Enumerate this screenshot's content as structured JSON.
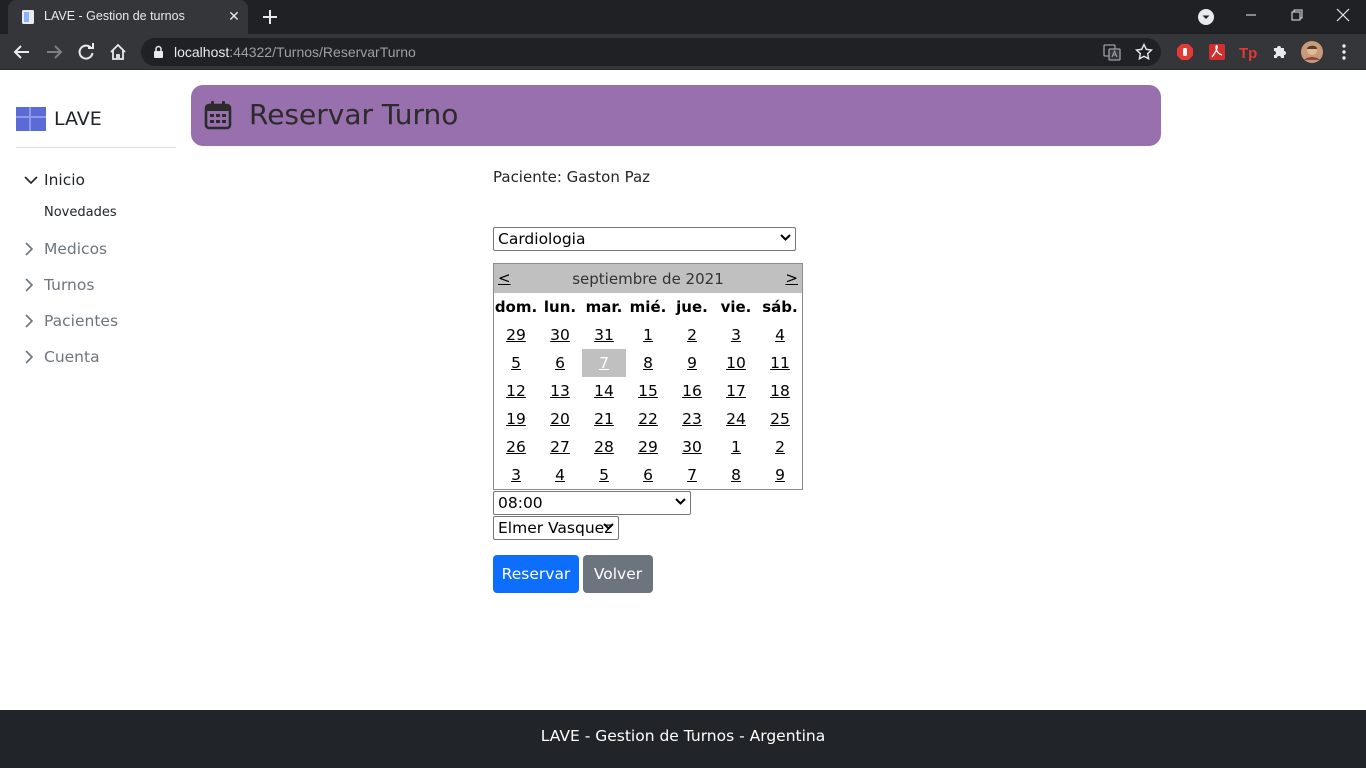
{
  "browser": {
    "tab_title": "LAVE - Gestion de turnos",
    "url_host": "localhost",
    "url_rest": ":44322/Turnos/ReservarTurno"
  },
  "sidebar": {
    "brand": "LAVE",
    "items": [
      {
        "label": "Inicio",
        "expanded": true
      },
      {
        "label": "Medicos",
        "expanded": false
      },
      {
        "label": "Turnos",
        "expanded": false
      },
      {
        "label": "Pacientes",
        "expanded": false
      },
      {
        "label": "Cuenta",
        "expanded": false
      }
    ],
    "subitems": [
      "Novedades"
    ]
  },
  "header": {
    "title": "Reservar Turno"
  },
  "patient_label": "Paciente: Gaston Paz",
  "specialty_select": {
    "value": "Cardiologia"
  },
  "calendar": {
    "title": "septiembre de 2021",
    "prev": "<",
    "next": ">",
    "weekdays": [
      "dom.",
      "lun.",
      "mar.",
      "mié.",
      "jue.",
      "vie.",
      "sáb."
    ],
    "weeks": [
      [
        "29",
        "30",
        "31",
        "1",
        "2",
        "3",
        "4"
      ],
      [
        "5",
        "6",
        "7",
        "8",
        "9",
        "10",
        "11"
      ],
      [
        "12",
        "13",
        "14",
        "15",
        "16",
        "17",
        "18"
      ],
      [
        "19",
        "20",
        "21",
        "22",
        "23",
        "24",
        "25"
      ],
      [
        "26",
        "27",
        "28",
        "29",
        "30",
        "1",
        "2"
      ],
      [
        "3",
        "4",
        "5",
        "6",
        "7",
        "8",
        "9"
      ]
    ],
    "selected": {
      "week": 1,
      "day": 2
    }
  },
  "time_select": {
    "value": "08:00"
  },
  "doctor_select": {
    "value": "Elmer Vasquez"
  },
  "buttons": {
    "reserve": "Reservar",
    "back": "Volver"
  },
  "colors": {
    "banner": "#9870ad",
    "primary": "#0d6efd",
    "secondary": "#6c757d",
    "footer": "#212529"
  },
  "footer": {
    "text": "LAVE - Gestion de Turnos - Argentina"
  }
}
